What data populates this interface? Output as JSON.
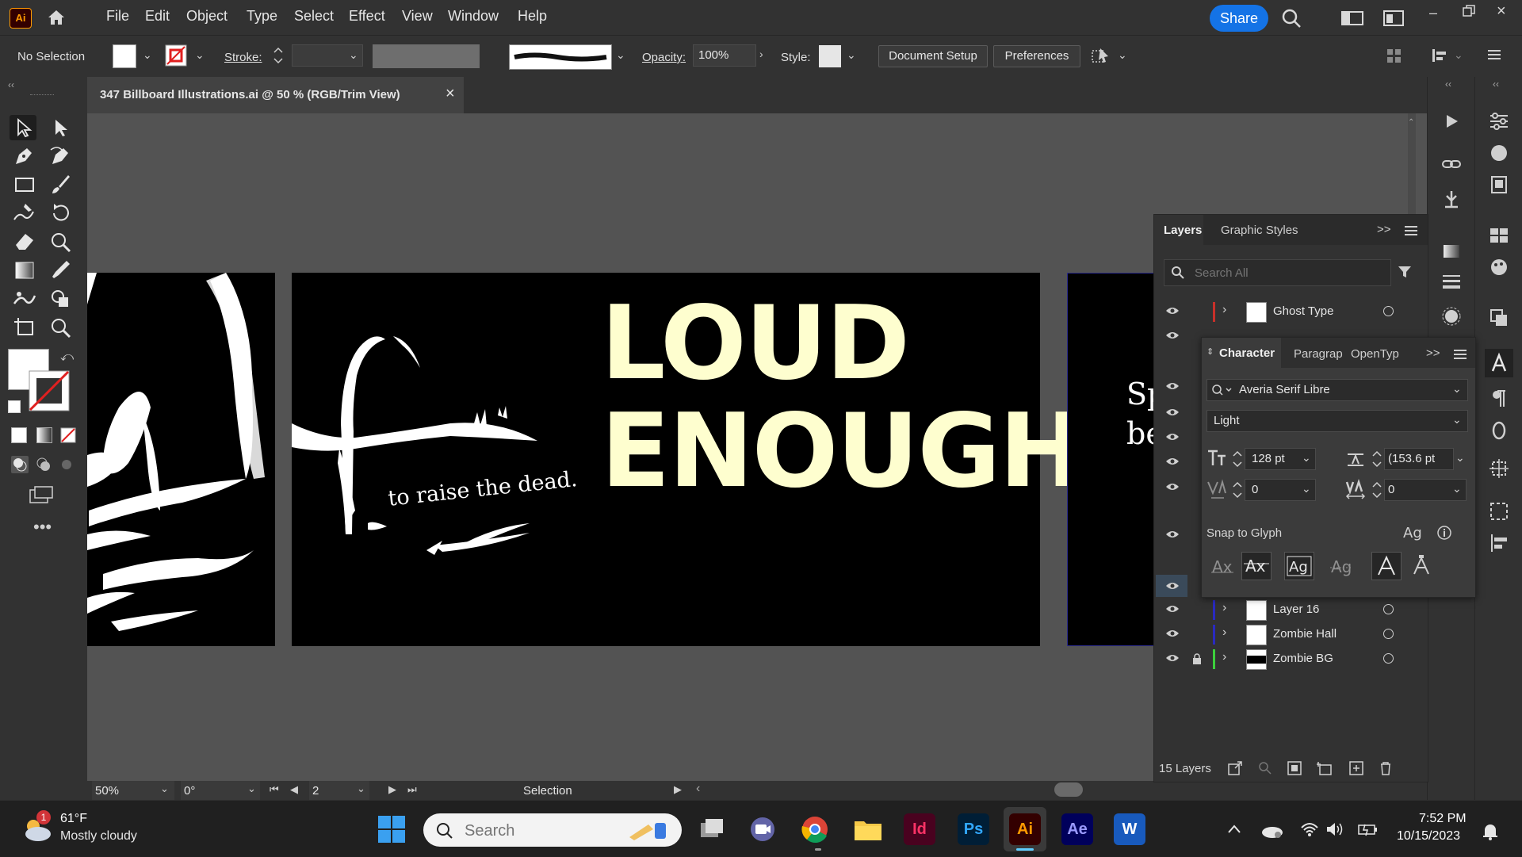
{
  "app": {
    "logo": "Ai",
    "share_label": "Share"
  },
  "menu": [
    "File",
    "Edit",
    "Object",
    "Type",
    "Select",
    "Effect",
    "View",
    "Window",
    "Help"
  ],
  "control": {
    "selection": "No Selection",
    "stroke_label": "Stroke:",
    "opacity_label": "Opacity:",
    "opacity_value": "100%",
    "style_label": "Style:",
    "doc_setup": "Document Setup",
    "preferences": "Preferences"
  },
  "document": {
    "tab_title": "347 Billboard Illustrations.ai @ 50 % (RGB/Trim View)",
    "close": "×"
  },
  "artwork": {
    "headline_line1": "LOUD",
    "headline_line2": "ENOUGH",
    "tagline": "to raise the dead.",
    "partial_text_1": "Sp",
    "partial_text_2": "be",
    "headline_color": "#fefecf"
  },
  "status": {
    "zoom": "50%",
    "rotation": "0°",
    "artboard": "2",
    "tool": "Selection"
  },
  "layers_panel": {
    "tabs": [
      "Layers",
      "Graphic Styles"
    ],
    "search_placeholder": "Search All",
    "rows": [
      {
        "name": "Ghost Type",
        "color": "#c8302a"
      },
      {
        "name": "Layer 16",
        "color": "#2a2ac0"
      },
      {
        "name": "Zombie Hall",
        "color": "#2a2ac0"
      },
      {
        "name": "Zombie BG",
        "color": "#3ccf3c"
      }
    ],
    "count": "15 Layers"
  },
  "character_panel": {
    "tabs": [
      "Character",
      "Paragrap",
      "OpenTyp"
    ],
    "font_family": "Averia Serif Libre",
    "font_style": "Light",
    "size": "128 pt",
    "leading": "(153.6 pt",
    "kerning": "0",
    "tracking": "0",
    "snap_label": "Snap to Glyph"
  },
  "taskbar": {
    "weather_temp": "61°F",
    "weather_desc": "Mostly cloudy",
    "weather_badge": "1",
    "search_placeholder": "Search",
    "time": "7:52 PM",
    "date": "10/15/2023",
    "apps": [
      "Id",
      "Ps",
      "Ai",
      "Ae",
      "W"
    ]
  }
}
